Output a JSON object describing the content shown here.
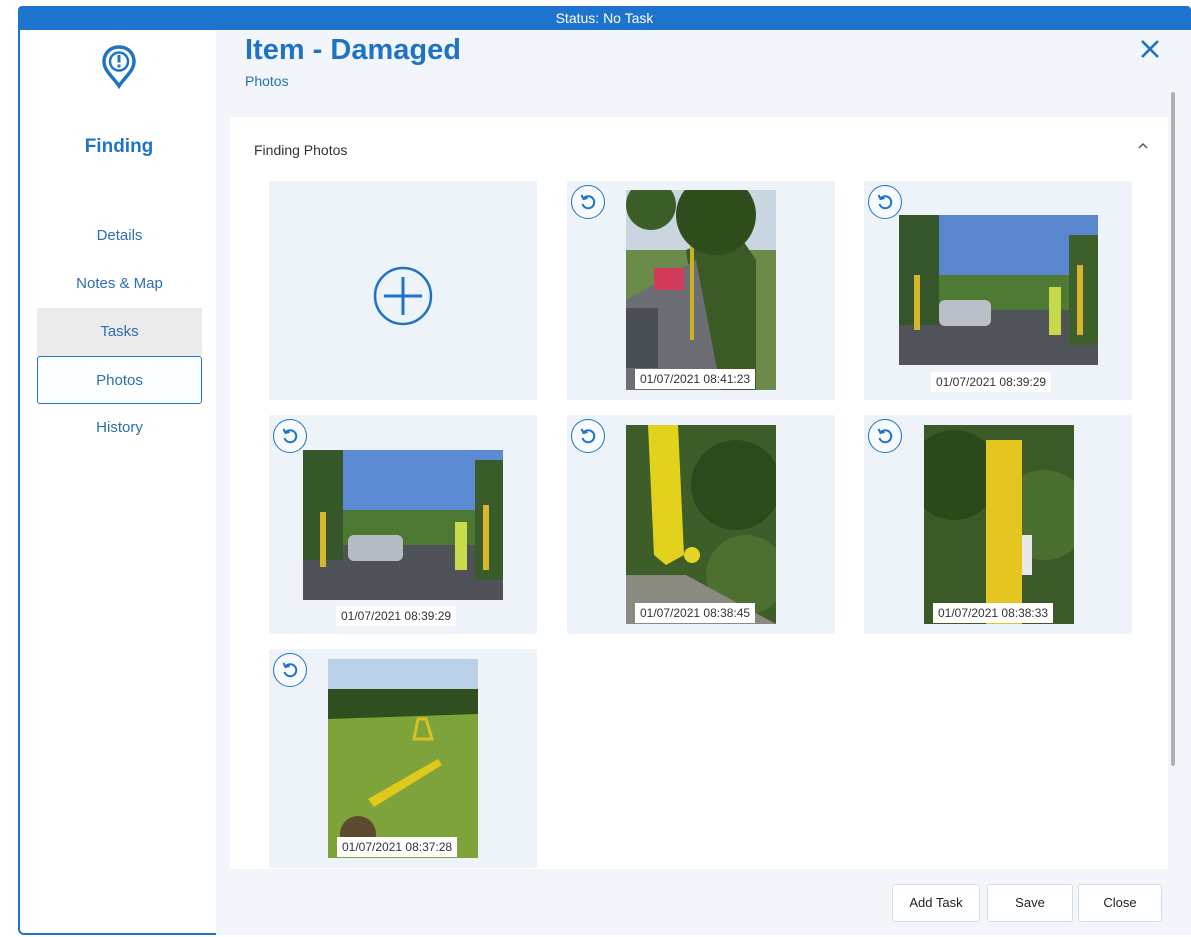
{
  "status_bar": {
    "text": "Status: No Task"
  },
  "sidebar": {
    "module_title": "Finding",
    "items": [
      {
        "label": "Details"
      },
      {
        "label": "Notes & Map"
      },
      {
        "label": "Tasks"
      },
      {
        "label": "Photos"
      },
      {
        "label": "History"
      }
    ]
  },
  "header": {
    "title": "Item - Damaged",
    "subtitle": "Photos"
  },
  "panel": {
    "title": "Finding Photos",
    "photos": [
      {
        "timestamp": "01/07/2021 08:41:23"
      },
      {
        "timestamp": "01/07/2021 08:39:29"
      },
      {
        "timestamp": "01/07/2021 08:39:29"
      },
      {
        "timestamp": "01/07/2021 08:38:45"
      },
      {
        "timestamp": "01/07/2021 08:38:33"
      },
      {
        "timestamp": "01/07/2021 08:37:28"
      }
    ]
  },
  "footer": {
    "add_task_label": "Add Task",
    "save_label": "Save",
    "close_label": "Close"
  },
  "colors": {
    "accent": "#1f73c4",
    "status_bar": "#1e73cf",
    "background": "#f2f6fb"
  },
  "icons": [
    "finding-pin-icon",
    "close-icon",
    "chevron-up-icon",
    "add-photo-icon",
    "rotate-icon"
  ]
}
